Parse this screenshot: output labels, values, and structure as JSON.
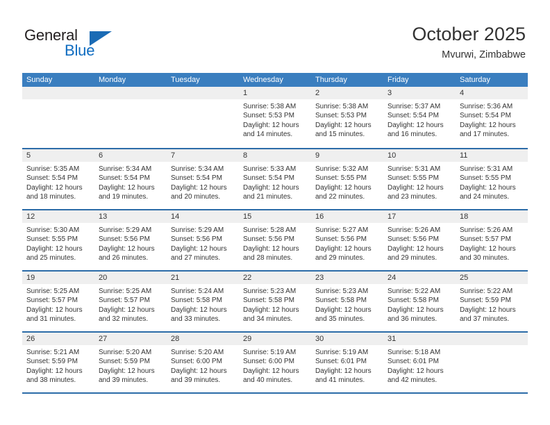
{
  "brand": {
    "name_line1": "General",
    "name_line2": "Blue",
    "color_dark": "#231f20",
    "color_blue": "#0f6cc0"
  },
  "header": {
    "title": "October 2025",
    "subtitle": "Mvurwi, Zimbabwe"
  },
  "theme": {
    "header_row_bg": "#3a7ebf",
    "week_divider": "#2c6ca8",
    "day_number_bg": "#efefef",
    "text": "#333333"
  },
  "weekdays": [
    "Sunday",
    "Monday",
    "Tuesday",
    "Wednesday",
    "Thursday",
    "Friday",
    "Saturday"
  ],
  "labels": {
    "sunrise": "Sunrise:",
    "sunset": "Sunset:",
    "daylight": "Daylight:"
  },
  "weeks": [
    [
      {
        "day": "",
        "empty": true
      },
      {
        "day": "",
        "empty": true
      },
      {
        "day": "",
        "empty": true
      },
      {
        "day": "1",
        "sunrise": "Sunrise: 5:38 AM",
        "sunset": "Sunset: 5:53 PM",
        "daylight": "Daylight: 12 hours and 14 minutes."
      },
      {
        "day": "2",
        "sunrise": "Sunrise: 5:38 AM",
        "sunset": "Sunset: 5:53 PM",
        "daylight": "Daylight: 12 hours and 15 minutes."
      },
      {
        "day": "3",
        "sunrise": "Sunrise: 5:37 AM",
        "sunset": "Sunset: 5:54 PM",
        "daylight": "Daylight: 12 hours and 16 minutes."
      },
      {
        "day": "4",
        "sunrise": "Sunrise: 5:36 AM",
        "sunset": "Sunset: 5:54 PM",
        "daylight": "Daylight: 12 hours and 17 minutes."
      }
    ],
    [
      {
        "day": "5",
        "sunrise": "Sunrise: 5:35 AM",
        "sunset": "Sunset: 5:54 PM",
        "daylight": "Daylight: 12 hours and 18 minutes."
      },
      {
        "day": "6",
        "sunrise": "Sunrise: 5:34 AM",
        "sunset": "Sunset: 5:54 PM",
        "daylight": "Daylight: 12 hours and 19 minutes."
      },
      {
        "day": "7",
        "sunrise": "Sunrise: 5:34 AM",
        "sunset": "Sunset: 5:54 PM",
        "daylight": "Daylight: 12 hours and 20 minutes."
      },
      {
        "day": "8",
        "sunrise": "Sunrise: 5:33 AM",
        "sunset": "Sunset: 5:54 PM",
        "daylight": "Daylight: 12 hours and 21 minutes."
      },
      {
        "day": "9",
        "sunrise": "Sunrise: 5:32 AM",
        "sunset": "Sunset: 5:55 PM",
        "daylight": "Daylight: 12 hours and 22 minutes."
      },
      {
        "day": "10",
        "sunrise": "Sunrise: 5:31 AM",
        "sunset": "Sunset: 5:55 PM",
        "daylight": "Daylight: 12 hours and 23 minutes."
      },
      {
        "day": "11",
        "sunrise": "Sunrise: 5:31 AM",
        "sunset": "Sunset: 5:55 PM",
        "daylight": "Daylight: 12 hours and 24 minutes."
      }
    ],
    [
      {
        "day": "12",
        "sunrise": "Sunrise: 5:30 AM",
        "sunset": "Sunset: 5:55 PM",
        "daylight": "Daylight: 12 hours and 25 minutes."
      },
      {
        "day": "13",
        "sunrise": "Sunrise: 5:29 AM",
        "sunset": "Sunset: 5:56 PM",
        "daylight": "Daylight: 12 hours and 26 minutes."
      },
      {
        "day": "14",
        "sunrise": "Sunrise: 5:29 AM",
        "sunset": "Sunset: 5:56 PM",
        "daylight": "Daylight: 12 hours and 27 minutes."
      },
      {
        "day": "15",
        "sunrise": "Sunrise: 5:28 AM",
        "sunset": "Sunset: 5:56 PM",
        "daylight": "Daylight: 12 hours and 28 minutes."
      },
      {
        "day": "16",
        "sunrise": "Sunrise: 5:27 AM",
        "sunset": "Sunset: 5:56 PM",
        "daylight": "Daylight: 12 hours and 29 minutes."
      },
      {
        "day": "17",
        "sunrise": "Sunrise: 5:26 AM",
        "sunset": "Sunset: 5:56 PM",
        "daylight": "Daylight: 12 hours and 29 minutes."
      },
      {
        "day": "18",
        "sunrise": "Sunrise: 5:26 AM",
        "sunset": "Sunset: 5:57 PM",
        "daylight": "Daylight: 12 hours and 30 minutes."
      }
    ],
    [
      {
        "day": "19",
        "sunrise": "Sunrise: 5:25 AM",
        "sunset": "Sunset: 5:57 PM",
        "daylight": "Daylight: 12 hours and 31 minutes."
      },
      {
        "day": "20",
        "sunrise": "Sunrise: 5:25 AM",
        "sunset": "Sunset: 5:57 PM",
        "daylight": "Daylight: 12 hours and 32 minutes."
      },
      {
        "day": "21",
        "sunrise": "Sunrise: 5:24 AM",
        "sunset": "Sunset: 5:58 PM",
        "daylight": "Daylight: 12 hours and 33 minutes."
      },
      {
        "day": "22",
        "sunrise": "Sunrise: 5:23 AM",
        "sunset": "Sunset: 5:58 PM",
        "daylight": "Daylight: 12 hours and 34 minutes."
      },
      {
        "day": "23",
        "sunrise": "Sunrise: 5:23 AM",
        "sunset": "Sunset: 5:58 PM",
        "daylight": "Daylight: 12 hours and 35 minutes."
      },
      {
        "day": "24",
        "sunrise": "Sunrise: 5:22 AM",
        "sunset": "Sunset: 5:58 PM",
        "daylight": "Daylight: 12 hours and 36 minutes."
      },
      {
        "day": "25",
        "sunrise": "Sunrise: 5:22 AM",
        "sunset": "Sunset: 5:59 PM",
        "daylight": "Daylight: 12 hours and 37 minutes."
      }
    ],
    [
      {
        "day": "26",
        "sunrise": "Sunrise: 5:21 AM",
        "sunset": "Sunset: 5:59 PM",
        "daylight": "Daylight: 12 hours and 38 minutes."
      },
      {
        "day": "27",
        "sunrise": "Sunrise: 5:20 AM",
        "sunset": "Sunset: 5:59 PM",
        "daylight": "Daylight: 12 hours and 39 minutes."
      },
      {
        "day": "28",
        "sunrise": "Sunrise: 5:20 AM",
        "sunset": "Sunset: 6:00 PM",
        "daylight": "Daylight: 12 hours and 39 minutes."
      },
      {
        "day": "29",
        "sunrise": "Sunrise: 5:19 AM",
        "sunset": "Sunset: 6:00 PM",
        "daylight": "Daylight: 12 hours and 40 minutes."
      },
      {
        "day": "30",
        "sunrise": "Sunrise: 5:19 AM",
        "sunset": "Sunset: 6:01 PM",
        "daylight": "Daylight: 12 hours and 41 minutes."
      },
      {
        "day": "31",
        "sunrise": "Sunrise: 5:18 AM",
        "sunset": "Sunset: 6:01 PM",
        "daylight": "Daylight: 12 hours and 42 minutes."
      },
      {
        "day": "",
        "empty": true
      }
    ]
  ]
}
